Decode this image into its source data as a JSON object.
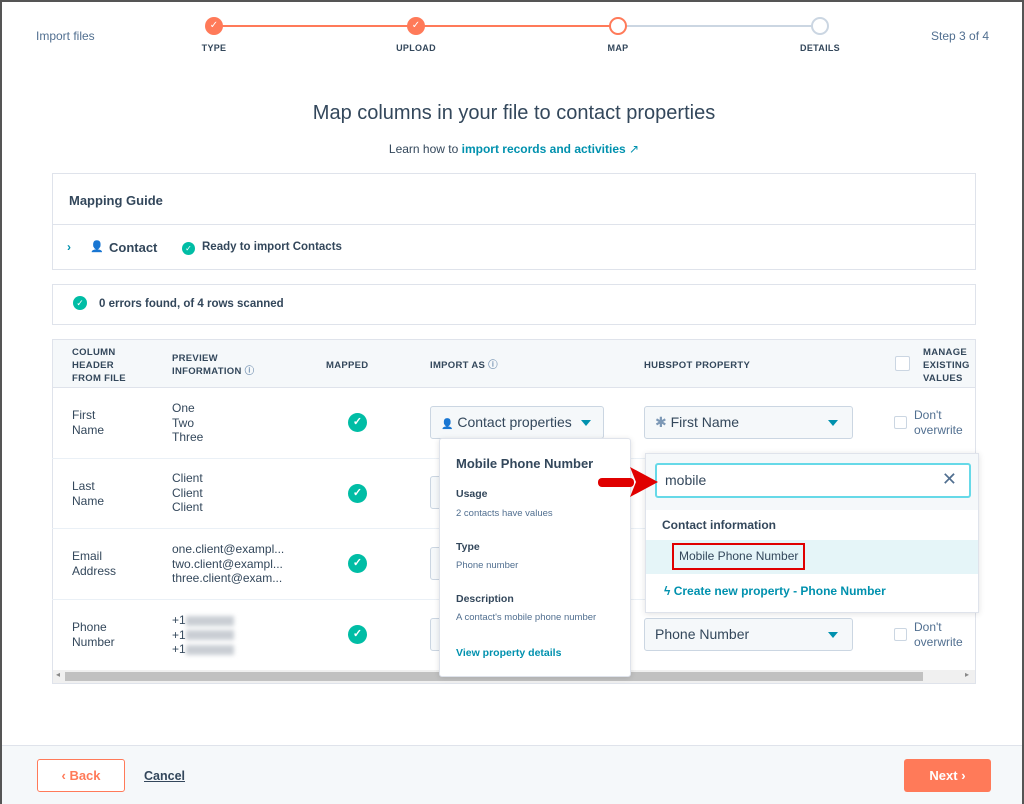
{
  "header": {
    "title": "Import files",
    "step_indicator": "Step 3 of 4",
    "steps": [
      {
        "label": "TYPE",
        "state": "done"
      },
      {
        "label": "UPLOAD",
        "state": "done"
      },
      {
        "label": "MAP",
        "state": "current"
      },
      {
        "label": "DETAILS",
        "state": "upcoming"
      }
    ]
  },
  "page": {
    "title": "Map columns in your file to contact properties",
    "learn_prefix": "Learn how to",
    "learn_link": "import records and activities"
  },
  "guide": {
    "title": "Mapping Guide",
    "object": "Contact",
    "status": "Ready to import Contacts"
  },
  "scan": {
    "text": "0 errors found, of 4 rows scanned"
  },
  "table": {
    "headers": {
      "column": [
        "COLUMN",
        "HEADER",
        "FROM FILE"
      ],
      "preview": [
        "PREVIEW",
        "INFORMATION"
      ],
      "mapped": "MAPPED",
      "import_as": "IMPORT AS",
      "hubspot": "HUBSPOT PROPERTY",
      "manage": [
        "MANAGE",
        "EXISTING",
        "VALUES"
      ]
    },
    "rows": [
      {
        "header": [
          "First",
          "Name"
        ],
        "preview": [
          "One",
          "Two",
          "Three"
        ],
        "import_as": "Contact properties",
        "property": "First Name",
        "overwrite": [
          "Don't",
          "overwrite"
        ]
      },
      {
        "header": [
          "Last",
          "Name"
        ],
        "preview": [
          "Client",
          "Client",
          "Client"
        ]
      },
      {
        "header": [
          "Email",
          "Address"
        ],
        "preview": [
          "one.client@exampl...",
          "two.client@exampl...",
          "three.client@exam..."
        ]
      },
      {
        "header": [
          "Phone",
          "Number"
        ],
        "preview": [
          "+1",
          "+1",
          "+1"
        ],
        "property": "Phone Number",
        "overwrite": [
          "Don't",
          "overwrite"
        ]
      }
    ]
  },
  "popover": {
    "title": "Mobile Phone Number",
    "usage_label": "Usage",
    "usage": "2 contacts have values",
    "type_label": "Type",
    "type": "Phone number",
    "desc_label": "Description",
    "desc": "A contact's mobile phone number",
    "link": "View property details"
  },
  "dropdown": {
    "search_value": "mobile",
    "group": "Contact information",
    "option": "Mobile Phone Number",
    "create": "Create new property - Phone Number"
  },
  "footer": {
    "back": "Back",
    "cancel": "Cancel",
    "next": "Next"
  },
  "colors": {
    "accent": "#ff7a59",
    "teal": "#00bda5",
    "link": "#0091ae",
    "annotation": "#e00000"
  }
}
